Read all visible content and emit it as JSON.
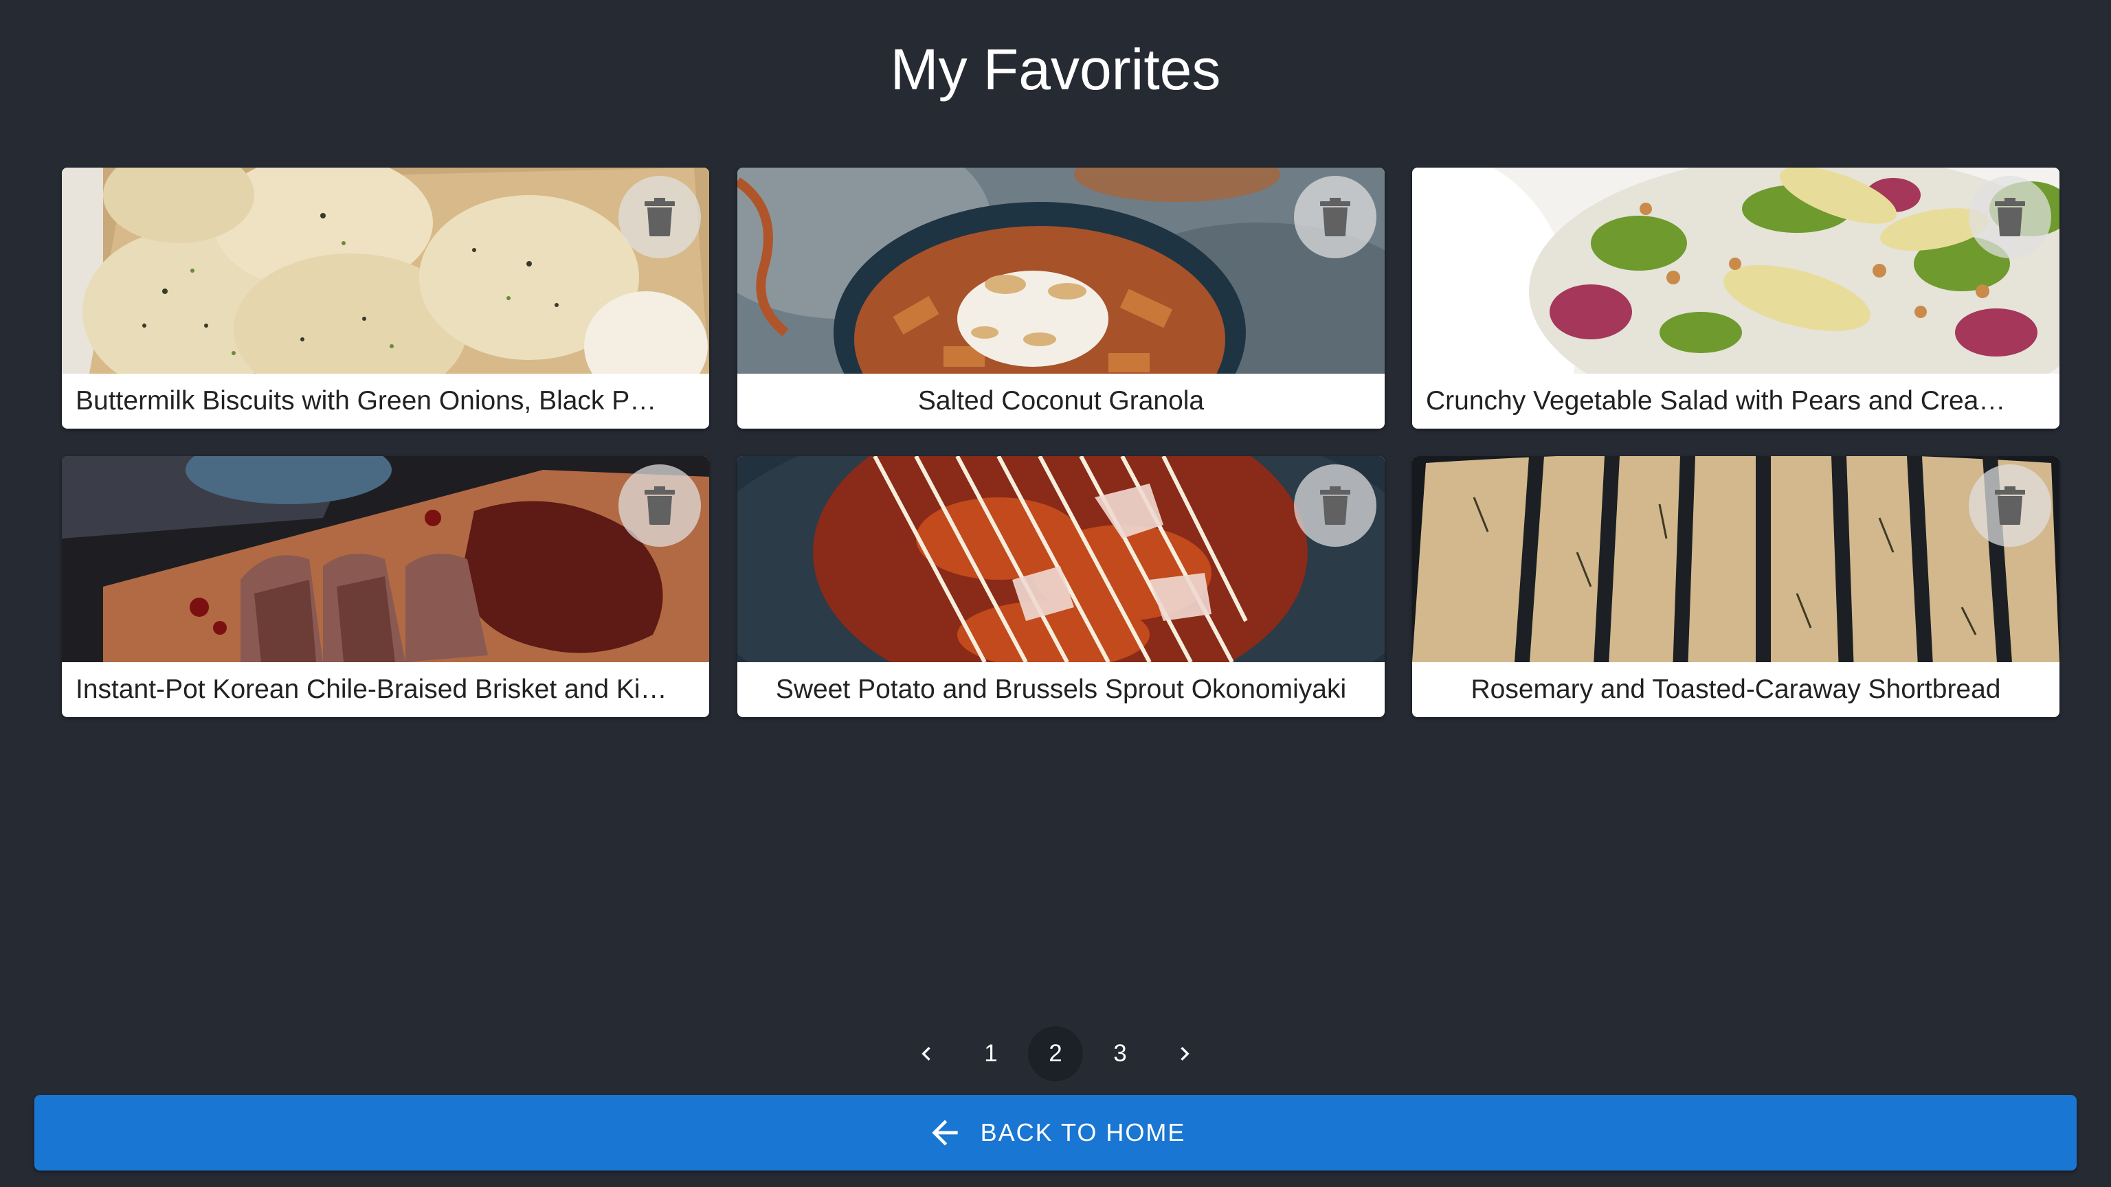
{
  "page": {
    "title": "My Favorites",
    "colors": {
      "background": "#262a33",
      "primary_button": "#1976d2",
      "card_label_bg": "#ffffff",
      "selected_page_bg": "#1c2027"
    }
  },
  "favorites": [
    {
      "title": "Buttermilk Biscuits with Green Onions, Black P…",
      "image": "biscuits",
      "delete_icon": "trash-icon"
    },
    {
      "title": "Salted Coconut Granola",
      "image": "granola",
      "delete_icon": "trash-icon"
    },
    {
      "title": "Crunchy Vegetable Salad with Pears and Crea…",
      "image": "salad",
      "delete_icon": "trash-icon"
    },
    {
      "title": "Instant-Pot Korean Chile-Braised Brisket and Ki…",
      "image": "brisket",
      "delete_icon": "trash-icon"
    },
    {
      "title": "Sweet Potato and Brussels Sprout Okonomiyaki",
      "image": "okonomiyaki",
      "delete_icon": "trash-icon"
    },
    {
      "title": "Rosemary and Toasted-Caraway Shortbread",
      "image": "shortbread",
      "delete_icon": "trash-icon"
    }
  ],
  "pagination": {
    "prev_icon": "chevron-left-icon",
    "next_icon": "chevron-right-icon",
    "pages": [
      "1",
      "2",
      "3"
    ],
    "current": "2"
  },
  "back_button": {
    "label": "BACK TO HOME",
    "icon": "arrow-left-icon"
  }
}
